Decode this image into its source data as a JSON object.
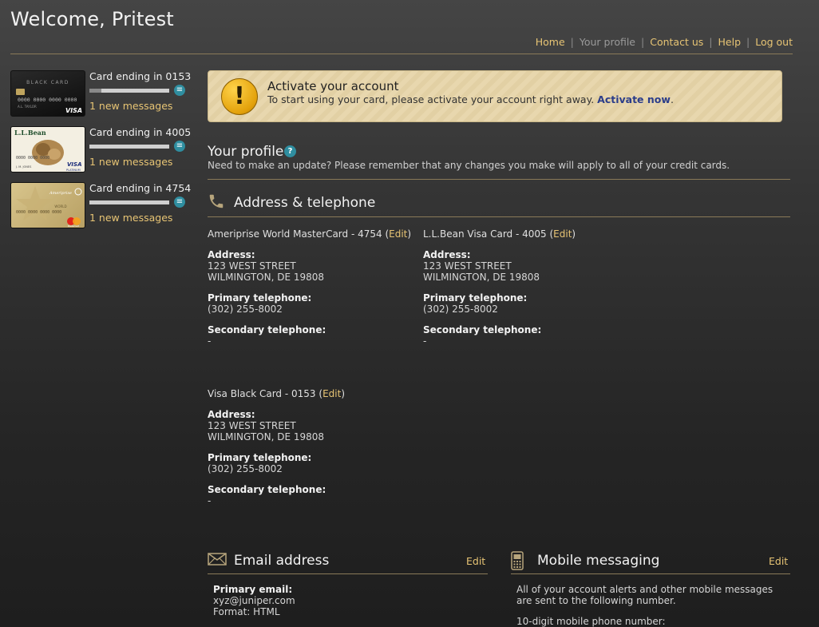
{
  "header": {
    "welcome": "Welcome, Pritest",
    "nav": [
      {
        "label": "Home",
        "current": false
      },
      {
        "label": "Your profile",
        "current": true
      },
      {
        "label": "Contact us",
        "current": false
      },
      {
        "label": "Help",
        "current": false
      },
      {
        "label": "Log out",
        "current": false
      }
    ]
  },
  "sidebar": {
    "cards": [
      {
        "title": "Card ending in 0153",
        "messages": "1 new messages",
        "image": "visa-black-card",
        "bar_fill": 0.15
      },
      {
        "title": "Card ending in 4005",
        "messages": "1 new messages",
        "image": "llbean-visa-card",
        "bar_fill": 0.0
      },
      {
        "title": "Card ending in 4754",
        "messages": "1 new messages",
        "image": "ameriprise-mastercard",
        "bar_fill": 0.0
      }
    ]
  },
  "card_images": {
    "black": {
      "brand": "BLACK CARD",
      "number": "0000 0000 0000 0000",
      "name": "A.L. TAYLOR",
      "network": "VISA"
    },
    "llbean": {
      "brand": "L.L.Bean",
      "number": "0000 0000 0000",
      "name": "J. M. JONES",
      "network": "VISA",
      "tier": "PLATINUM"
    },
    "ameriprise": {
      "brand": "Ameriprise",
      "tier": "WORLD",
      "number": "0000 0000 0000 0000",
      "network": "MasterCard"
    }
  },
  "activate": {
    "title": "Activate your account",
    "text": "To start using your card, please activate your account right away.",
    "link": "Activate now",
    "after": "."
  },
  "profile": {
    "title": "Your profile",
    "help": "?",
    "description": "Need to make an update? Please remember that any changes you make will apply to all of your credit cards."
  },
  "address_section": {
    "title": "Address & telephone",
    "cards": [
      {
        "name": "Ameriprise World MasterCard - 4754",
        "edit": "Edit",
        "address_label": "Address:",
        "address_line1": "123 WEST STREET",
        "address_line2": "WILMINGTON, DE 19808",
        "primary_label": "Primary telephone:",
        "primary": "(302) 255-8002",
        "secondary_label": "Secondary telephone:",
        "secondary": "-"
      },
      {
        "name": "L.L.Bean Visa Card - 4005",
        "edit": "Edit",
        "address_label": "Address:",
        "address_line1": "123 WEST STREET",
        "address_line2": "WILMINGTON, DE 19808",
        "primary_label": "Primary telephone:",
        "primary": "(302) 255-8002",
        "secondary_label": "Secondary telephone:",
        "secondary": "-"
      },
      {
        "name": "Visa Black Card - 0153",
        "edit": "Edit",
        "address_label": "Address:",
        "address_line1": "123 WEST STREET",
        "address_line2": "WILMINGTON, DE 19808",
        "primary_label": "Primary telephone:",
        "primary": "(302) 255-8002",
        "secondary_label": "Secondary telephone:",
        "secondary": "-"
      }
    ]
  },
  "email": {
    "title": "Email address",
    "edit": "Edit",
    "primary_label": "Primary email:",
    "value": "xyz@juniper.com",
    "format": "Format: HTML"
  },
  "mobile": {
    "title": "Mobile messaging",
    "edit": "Edit",
    "description": "All of your account alerts and other mobile messages are sent to the following number.",
    "phone_label": "10-digit mobile phone number:"
  },
  "colors": {
    "accent_link": "#e7c474",
    "info_icon": "#2f8ea0",
    "rule": "#8a7a58"
  }
}
